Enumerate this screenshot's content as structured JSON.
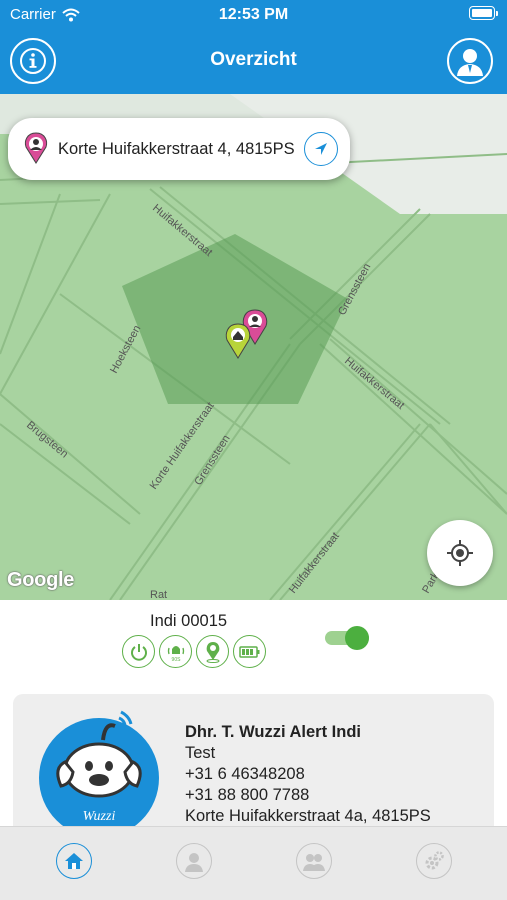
{
  "status_bar": {
    "carrier": "Carrier",
    "time": "12:53 PM"
  },
  "header": {
    "title": "Overzicht",
    "info_icon": "info-icon",
    "profile_icon": "user-profile-icon",
    "color": "#1a8fd8"
  },
  "map": {
    "address": "Korte Huifakkerstraat 4, 4815PS",
    "provider_logo": "Google",
    "streets": [
      "Huifakkerstraat",
      "Grenssteen",
      "Hoeksteen",
      "Brugsteen",
      "Korte Huifakkerstraat",
      "Grenssteen",
      "Huifakkerstraat",
      "Huifakkerstraat",
      "Rat",
      "Parkl"
    ],
    "geofence_color": "#5a9d55",
    "map_color": "#a8d3a0"
  },
  "device": {
    "name": "Indi 00015",
    "status_icons": [
      "power-icon",
      "alarm-bell-icon",
      "location-pin-icon",
      "battery-icon"
    ],
    "alarm_label": "90S",
    "tracking_enabled": true,
    "accent": "#5fb04a"
  },
  "contact": {
    "name": "Dhr. T. Wuzzi Alert Indi",
    "line1": "Test",
    "phone1": "+31 6 46348208",
    "phone2": "+31 88 800 7788",
    "address": "Korte Huifakkerstraat 4a, 4815PS",
    "logo_text": "Wuzzi"
  },
  "tabbar": {
    "tabs": [
      "home-tab",
      "profile-tab",
      "contacts-tab",
      "settings-tab"
    ],
    "active": "home-tab"
  }
}
